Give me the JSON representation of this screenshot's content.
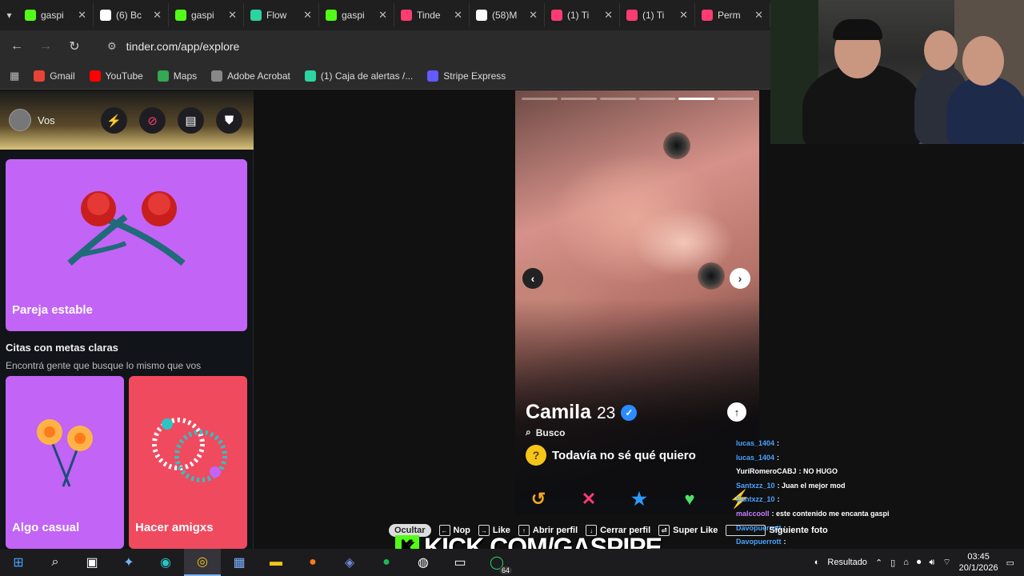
{
  "browser": {
    "tabs": [
      {
        "label": "gaspi",
        "icon": "kick-icon",
        "color": "#53fc18"
      },
      {
        "label": "(6) Bc",
        "icon": "x-icon",
        "color": "#ffffff"
      },
      {
        "label": "gaspi",
        "icon": "kick-icon",
        "color": "#53fc18"
      },
      {
        "label": "Flow",
        "icon": "flow-icon",
        "color": "#2bd4a0"
      },
      {
        "label": "gaspi",
        "icon": "kick-icon",
        "color": "#53fc18"
      },
      {
        "label": "Tinde",
        "icon": "tinder-icon",
        "color": "#fe3c72"
      },
      {
        "label": "(58)M",
        "icon": "tiktok-icon",
        "color": "#ffffff"
      },
      {
        "label": "(1) Ti",
        "icon": "tinder-icon",
        "color": "#fe3c72"
      },
      {
        "label": "(1) Ti",
        "icon": "tinder-icon",
        "color": "#fe3c72"
      },
      {
        "label": "Perm",
        "icon": "tinder-icon",
        "color": "#fe3c72"
      }
    ],
    "url": "tinder.com/app/explore",
    "bookmarks": [
      {
        "label": "Gmail",
        "color": "#ea4335"
      },
      {
        "label": "YouTube",
        "color": "#ff0000"
      },
      {
        "label": "Maps",
        "color": "#34a853"
      },
      {
        "label": "Adobe Acrobat",
        "color": "#888888"
      },
      {
        "label": "(1) Caja de alertas /...",
        "color": "#2bd4a0"
      },
      {
        "label": "Stripe Express",
        "color": "#635bff"
      }
    ]
  },
  "left_panel": {
    "user_label": "Vos",
    "cards": {
      "pareja": "Pareja estable",
      "casual": "Algo casual",
      "amigos": "Hacer amigxs"
    },
    "section_title": "Citas con metas claras",
    "section_subtitle": "Encontrá gente que busque lo mismo que vos"
  },
  "profile": {
    "name": "Camila",
    "age": "23",
    "busco_label": "Busco",
    "goal": "Todavía no sé qué quiero",
    "photo_count": 6,
    "active_photo": 5
  },
  "chat": [
    {
      "user": "lucas_1404",
      "msg": ":",
      "color": "#4aa3ff"
    },
    {
      "user": "lucas_1404",
      "msg": ":",
      "color": "#4aa3ff"
    },
    {
      "user": "YuriRomeroCABJ",
      "msg": ": NO HUGO",
      "color": "#ffffff"
    },
    {
      "user": "Santxzz_10",
      "msg": ": Juan el mejor mod",
      "color": "#4aa3ff"
    },
    {
      "user": "Santxzz_10",
      "msg": ":",
      "color": "#4aa3ff"
    },
    {
      "user": "malccooll",
      "msg": ": este contenido me encanta gaspi",
      "color": "#c77dff"
    },
    {
      "user": "Davopuerrott",
      "msg": ":",
      "color": "#4aa3ff"
    },
    {
      "user": "Davopuerrott",
      "msg": ":",
      "color": "#4aa3ff"
    },
    {
      "user": "Davopuerrott",
      "msg": ":",
      "color": "#4aa3ff"
    },
    {
      "user": "Davopuerrott",
      "msg": ":",
      "color": "#4aa3ff"
    }
  ],
  "shortcuts": {
    "ocultar": "Ocultar",
    "nop": "Nop",
    "like": "Like",
    "abrir": "Abrir perfil",
    "cerrar": "Cerrar perfil",
    "super": "Super Like",
    "siguiente": "Siguiente foto"
  },
  "overlay": {
    "kick_text": "KICK.COM/GASPIPE"
  },
  "taskbar": {
    "resultado": "Resultado",
    "time": "03:45",
    "date": "20/1/2026",
    "badge": "64"
  }
}
